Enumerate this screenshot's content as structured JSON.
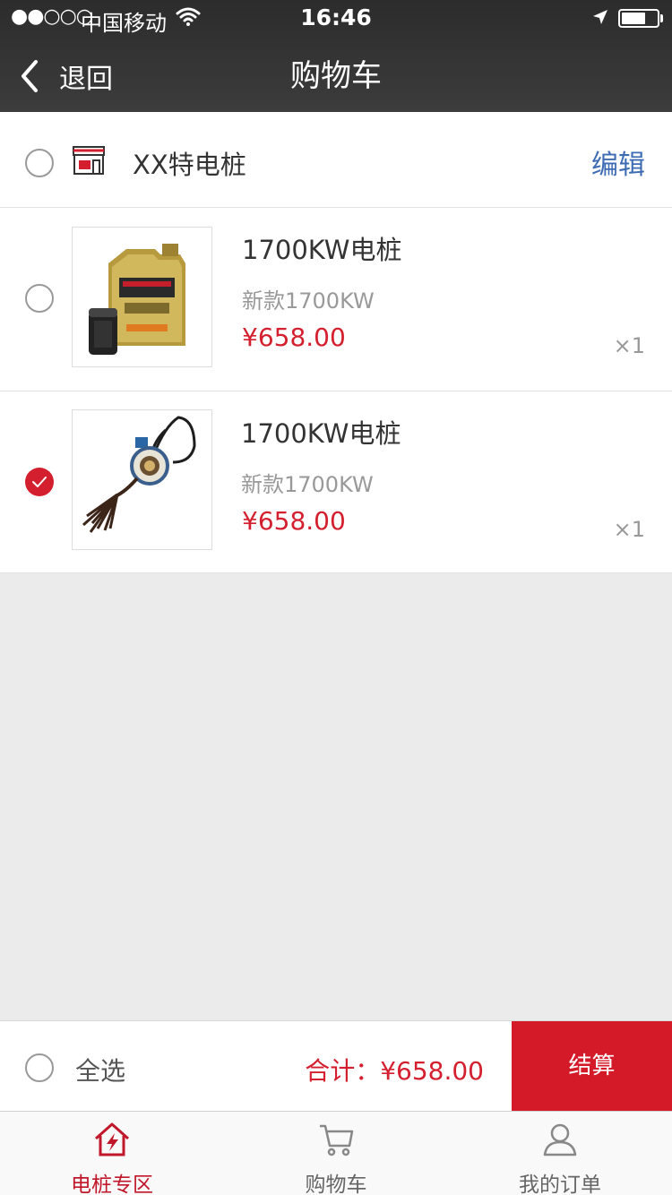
{
  "status_bar": {
    "signal": "●●○○○",
    "carrier": "中国移动",
    "time": "16:46"
  },
  "nav": {
    "back_label": "退回",
    "title": "购物车"
  },
  "shop": {
    "name": "XX特电桩",
    "edit_label": "编辑",
    "icon": "storefront-icon"
  },
  "items": [
    {
      "name": "1700KW电桩",
      "subtitle": "新款1700KW",
      "price": "¥658.00",
      "qty": "×1",
      "checked": false,
      "image": "motor-oil-bottle"
    },
    {
      "name": "1700KW电桩",
      "subtitle": "新款1700KW",
      "price": "¥658.00",
      "qty": "×1",
      "checked": true,
      "image": "car-pendant-tassel"
    }
  ],
  "checkout": {
    "select_all_label": "全选",
    "total": "合计：¥658.00",
    "pay_label": "结算"
  },
  "tabs": [
    {
      "label": "电桩专区",
      "icon": "charging-house-icon",
      "active": true
    },
    {
      "label": "购物车",
      "icon": "cart-icon",
      "active": false
    },
    {
      "label": "我的订单",
      "icon": "user-icon",
      "active": false
    }
  ],
  "colors": {
    "accent": "#d41f2e",
    "edit_link": "#3d6cb4",
    "header_bg": "#2c2c2c"
  }
}
